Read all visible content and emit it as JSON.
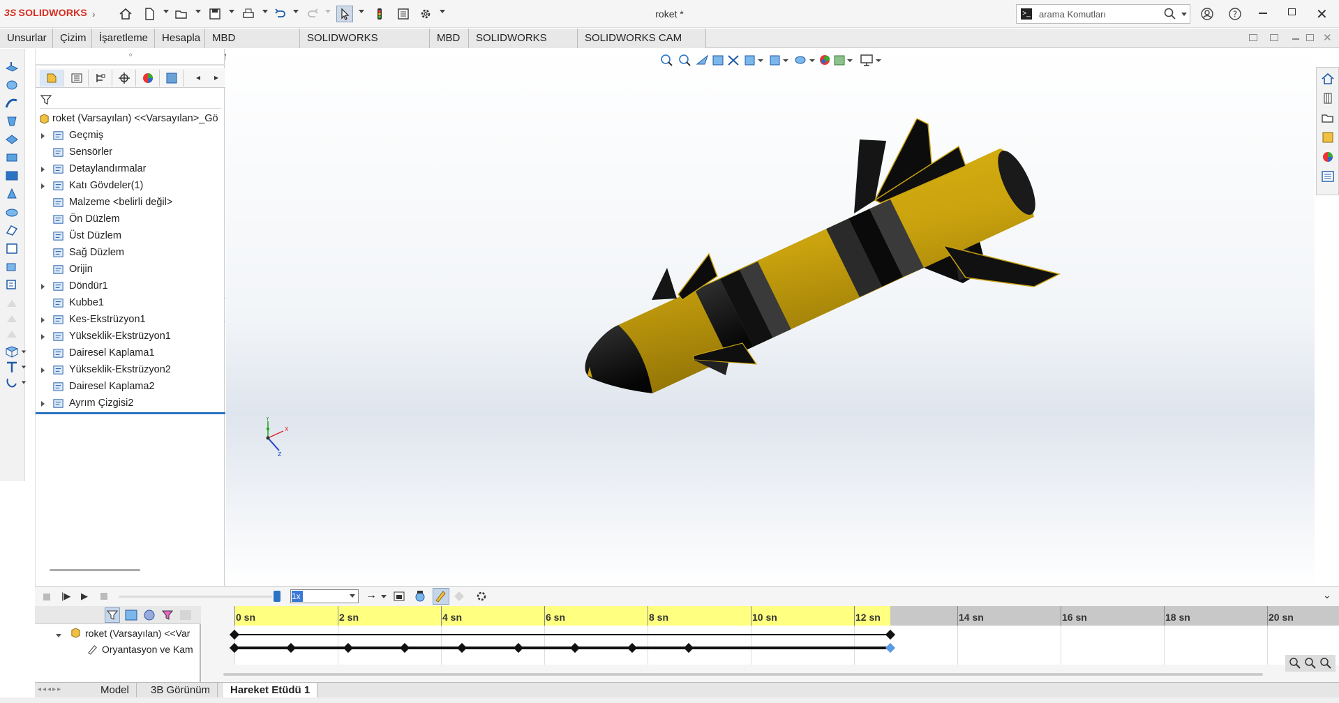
{
  "app": {
    "brand": "SOLIDWORKS",
    "document_title": "roket *"
  },
  "search": {
    "placeholder": "arama Komutları"
  },
  "command_tabs": [
    "Unsurlar",
    "Çizim",
    "İşaretleme",
    "Hesapla",
    "MBD Dimensions",
    "SOLIDWORKS Eklentileri",
    "MBD",
    "SOLIDWORKS CAM",
    "SOLIDWORKS CAM TBM"
  ],
  "feature_tree": {
    "root": "roket (Varsayılan) <<Varsayılan>_Gö",
    "items": [
      {
        "label": "Geçmiş",
        "expandable": true,
        "icon": "history-icon"
      },
      {
        "label": "Sensörler",
        "expandable": false,
        "icon": "sensor-icon"
      },
      {
        "label": "Detaylandırmalar",
        "expandable": true,
        "icon": "annotation-icon"
      },
      {
        "label": "Katı Gövdeler(1)",
        "expandable": true,
        "icon": "solid-bodies-icon"
      },
      {
        "label": "Malzeme <belirli değil>",
        "expandable": false,
        "icon": "material-icon"
      },
      {
        "label": "Ön Düzlem",
        "expandable": false,
        "icon": "plane-icon"
      },
      {
        "label": "Üst Düzlem",
        "expandable": false,
        "icon": "plane-icon"
      },
      {
        "label": "Sağ Düzlem",
        "expandable": false,
        "icon": "plane-icon"
      },
      {
        "label": "Orijin",
        "expandable": false,
        "icon": "origin-icon"
      },
      {
        "label": "Döndür1",
        "expandable": true,
        "icon": "revolve-icon"
      },
      {
        "label": "Kubbe1",
        "expandable": false,
        "icon": "dome-icon"
      },
      {
        "label": "Kes-Ekstrüzyon1",
        "expandable": true,
        "icon": "cut-extrude-icon"
      },
      {
        "label": "Yükseklik-Ekstrüzyon1",
        "expandable": true,
        "icon": "boss-extrude-icon"
      },
      {
        "label": "Dairesel Kaplama1",
        "expandable": false,
        "icon": "circular-pattern-icon"
      },
      {
        "label": "Yükseklik-Ekstrüzyon2",
        "expandable": true,
        "icon": "boss-extrude-icon"
      },
      {
        "label": "Dairesel Kaplama2",
        "expandable": false,
        "icon": "circular-pattern-icon"
      },
      {
        "label": "Ayrım Çizgisi2",
        "expandable": true,
        "icon": "split-line-icon"
      }
    ]
  },
  "triad": {
    "x": "X",
    "y": "Y",
    "z": "Z"
  },
  "motion_study": {
    "speed": "1x",
    "timeline_labels": [
      "0 sn",
      "2 sn",
      "4 sn",
      "6 sn",
      "8 sn",
      "10 sn",
      "12 sn",
      "14 sn",
      "16 sn",
      "18 sn",
      "20 sn"
    ],
    "timeline_seconds": [
      0,
      2,
      4,
      6,
      8,
      10,
      12,
      14,
      16,
      18,
      20
    ],
    "end_time_seconds": 12.7,
    "orientation_key_seconds": [
      0,
      1.1,
      2.2,
      3.3,
      4.4,
      5.5,
      6.6,
      7.7,
      8.8,
      12.7
    ],
    "tree_root": "roket (Varsayılan) <<Var",
    "tree_child": "Oryantasyon ve Kam"
  },
  "bottom_tabs": [
    "Model",
    "3B Görünüm",
    "Hareket Etüdü 1"
  ],
  "colors": {
    "rocket_body": "#c9a20e",
    "rocket_band": "#1a1a1a",
    "timeline_active": "#ffff80",
    "accent": "#d52b1e"
  }
}
